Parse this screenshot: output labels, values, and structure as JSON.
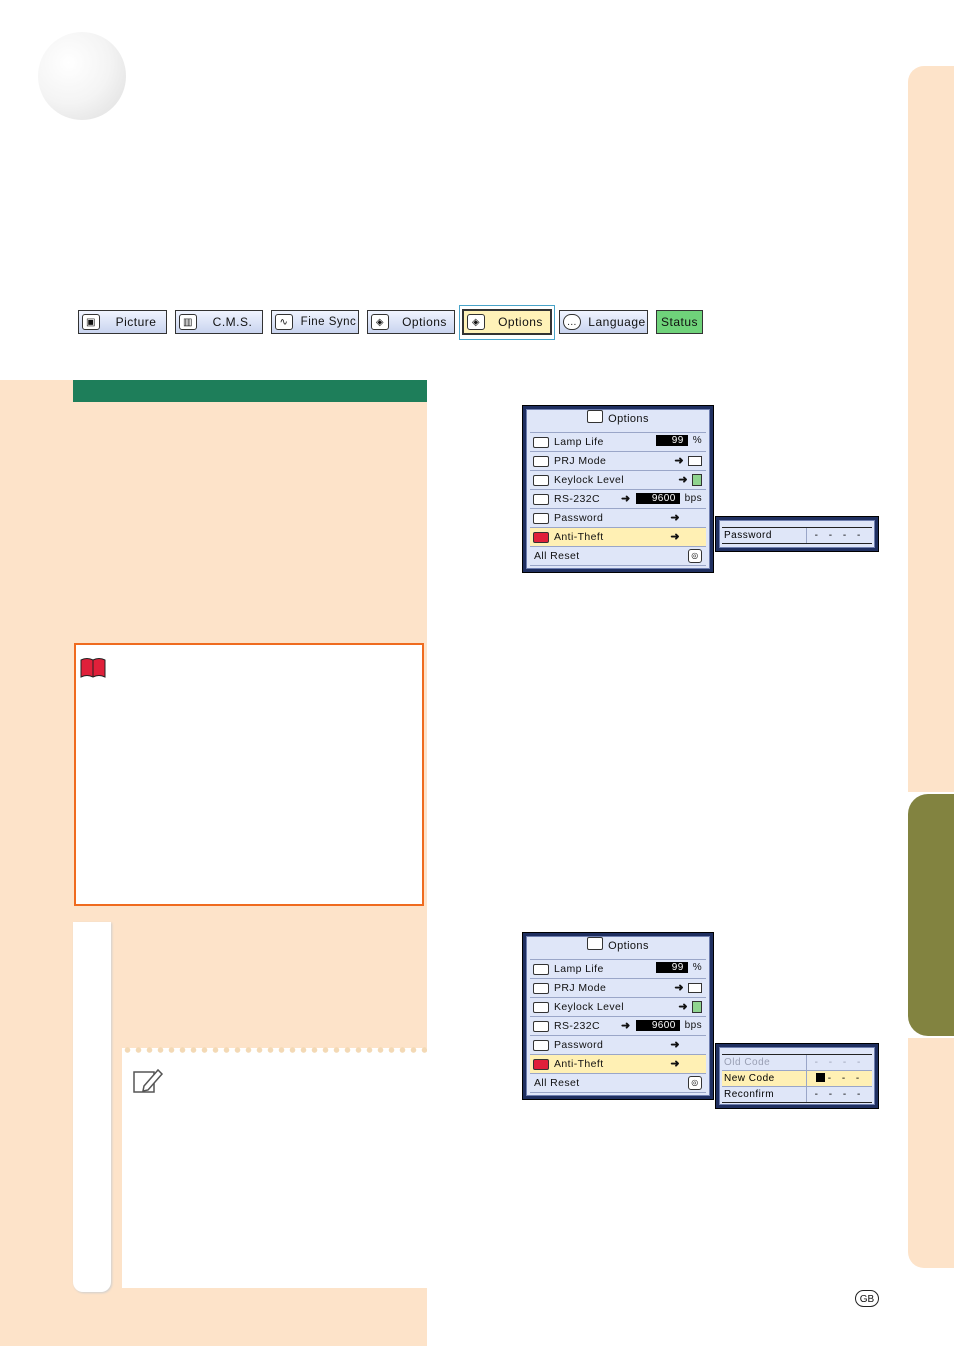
{
  "tabs": [
    {
      "label": "Picture",
      "icon": "picture-icon"
    },
    {
      "label": "C.M.S.",
      "icon": "cms-icon"
    },
    {
      "label": "Fine Sync",
      "icon": "fine-sync-icon"
    },
    {
      "label": "Options",
      "icon": "options-icon"
    },
    {
      "label": "Options",
      "icon": "options-icon"
    },
    {
      "label": "Language",
      "icon": "language-icon"
    },
    {
      "label": "Status",
      "icon": ""
    }
  ],
  "osd": {
    "title": "Options",
    "rows": [
      {
        "name": "Lamp Life",
        "value": "99",
        "unit": "%"
      },
      {
        "name": "PRJ Mode"
      },
      {
        "name": "Keylock Level"
      },
      {
        "name": "RS-232C",
        "value": "9600",
        "unit": "bps"
      },
      {
        "name": "Password"
      },
      {
        "name": "Anti-Theft"
      },
      {
        "name": "All Reset"
      }
    ]
  },
  "password_box": {
    "label": "Password",
    "value": "- - - -"
  },
  "code_box": {
    "rows": [
      {
        "label": "Old Code",
        "value": "- - - -"
      },
      {
        "label": "New Code",
        "value": "- - -"
      },
      {
        "label": "Reconfirm",
        "value": "- - - -"
      }
    ]
  },
  "footer": {
    "region_badge": "GB"
  },
  "colors": {
    "accent_green": "#1e7e5a",
    "page_tint": "#fde3c9",
    "warning_border": "#ef6b1f",
    "side_tab_green": "#828340"
  }
}
